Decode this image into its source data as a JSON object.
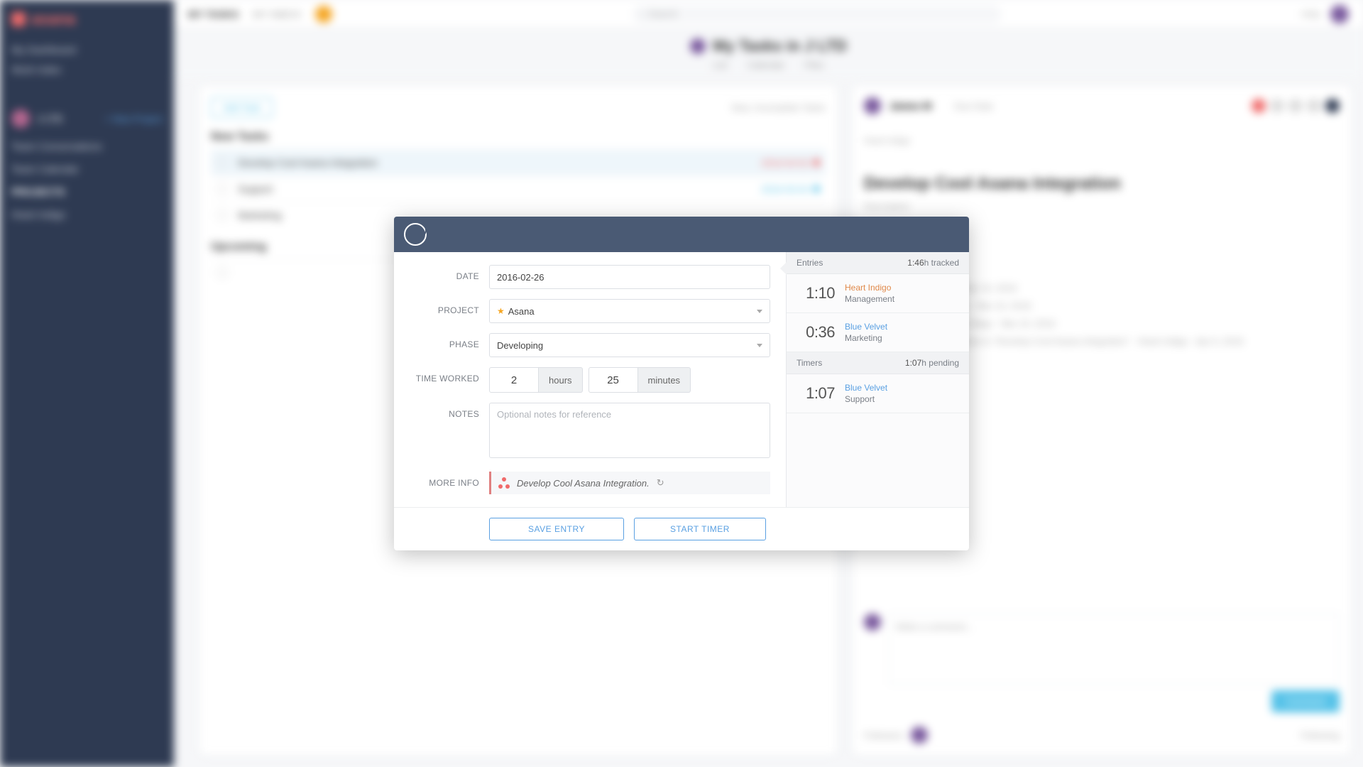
{
  "sidebar": {
    "app_name": "asana",
    "links": [
      "My Dashboard",
      "Work Index"
    ],
    "team_label": "J LTD",
    "team_tag": "+ New Project",
    "sub_items": [
      "Team Conversations",
      "Team Calendar",
      "PROJECTS",
      "Heart Indigo"
    ]
  },
  "topbar": {
    "tab1": "MY TASKS",
    "tab2": "MY INBOX",
    "search_placeholder": "Search",
    "help": "Help"
  },
  "page": {
    "title": "My Tasks in J LTD",
    "subtabs": [
      "List",
      "Calendar",
      "Files"
    ]
  },
  "tasklist": {
    "add_task": "Add Task",
    "toolbar_right": "New, Incomplete Tasks",
    "section_new": "New Tasks",
    "section_upcoming": "Upcoming",
    "tasks": [
      {
        "title": "Develop Cool Asana Integration",
        "meta": "2016-03-02"
      },
      {
        "title": "Support",
        "meta": "2016-03-04"
      },
      {
        "title": "Marketing",
        "meta": ""
      }
    ]
  },
  "detail": {
    "assignee": "James M",
    "due": "Due Date",
    "crumb": "Heart Indigo",
    "title": "Develop Cool Asana Integration",
    "desc": "Description",
    "activity1": "James M created task · Mar 10, 2016",
    "activity2": "James M assigned to you · Mar 10, 2016",
    "activity3": "James M added to Heart Indigo · Mar 10, 2016",
    "activity4": "James M changed the name to \"Develop Cool Asana Integration\" · Heart Indigo · Apr 6, 2016",
    "comment_placeholder": "Write a comment...",
    "comment_btn": "Comment",
    "followers": "Followers",
    "following": "Following"
  },
  "modal": {
    "labels": {
      "date": "DATE",
      "project": "PROJECT",
      "phase": "PHASE",
      "time_worked": "TIME WORKED",
      "notes": "NOTES",
      "more_info": "MORE INFO"
    },
    "date_value": "2016-02-26",
    "project_value": "Asana",
    "phase_value": "Developing",
    "hours_value": "2",
    "hours_unit": "hours",
    "minutes_value": "25",
    "minutes_unit": "minutes",
    "notes_placeholder": "Optional notes for reference",
    "more_info_text": "Develop Cool Asana Integration.",
    "save_label": "SAVE ENTRY",
    "start_label": "START TIMER"
  },
  "side": {
    "entries_label": "Entries",
    "entries_summary_value": "1:46",
    "entries_summary_suffix": "h tracked",
    "timers_label": "Timers",
    "timers_summary_value": "1:07",
    "timers_summary_suffix": "h pending",
    "entries": [
      {
        "time": "1:10",
        "client": "Heart Indigo",
        "project": "Management"
      },
      {
        "time": "0:36",
        "client": "Blue Velvet",
        "project": "Marketing"
      }
    ],
    "timers": [
      {
        "time": "1:07",
        "client": "Blue Velvet",
        "project": "Support"
      }
    ]
  }
}
